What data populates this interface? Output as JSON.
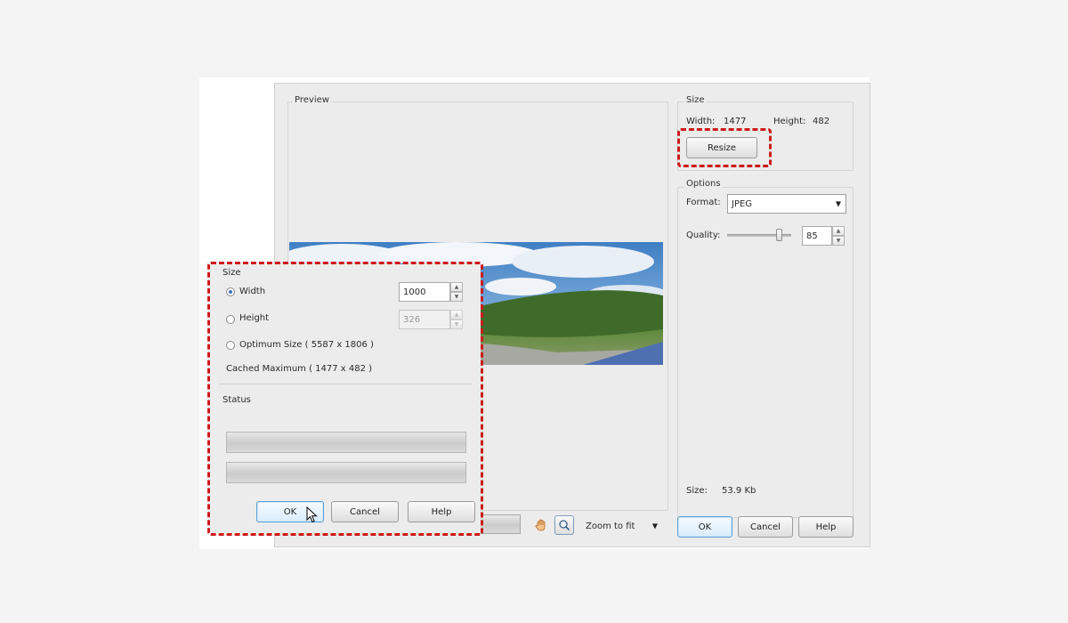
{
  "main_dialog": {
    "preview_label": "Preview",
    "size_group": {
      "label": "Size",
      "width_label": "Width:",
      "width_value": "1477",
      "height_label": "Height:",
      "height_value": "482",
      "resize_button": "Resize"
    },
    "options_group": {
      "label": "Options",
      "format_label": "Format:",
      "format_value": "JPEG",
      "quality_label": "Quality:",
      "quality_value": "85",
      "quality_level": 0.85
    },
    "file_size_label": "Size:",
    "file_size_value": "53.9 Kb",
    "zoom_value": "Zoom to fit",
    "buttons": {
      "ok": "OK",
      "cancel": "Cancel",
      "help": "Help"
    }
  },
  "resize_dialog": {
    "size_label": "Size",
    "width_option": "Width",
    "width_value": "1000",
    "height_option": "Height",
    "height_value": "326",
    "optimum_option": "Optimum Size ( 5587 x 1806 )",
    "cached_text": "Cached Maximum ( 1477 x 482 )",
    "status_label": "Status",
    "buttons": {
      "ok": "OK",
      "cancel": "Cancel",
      "help": "Help"
    }
  },
  "colors": {
    "highlight": "#cc1b1b",
    "default_button": "#5aa0d8"
  }
}
